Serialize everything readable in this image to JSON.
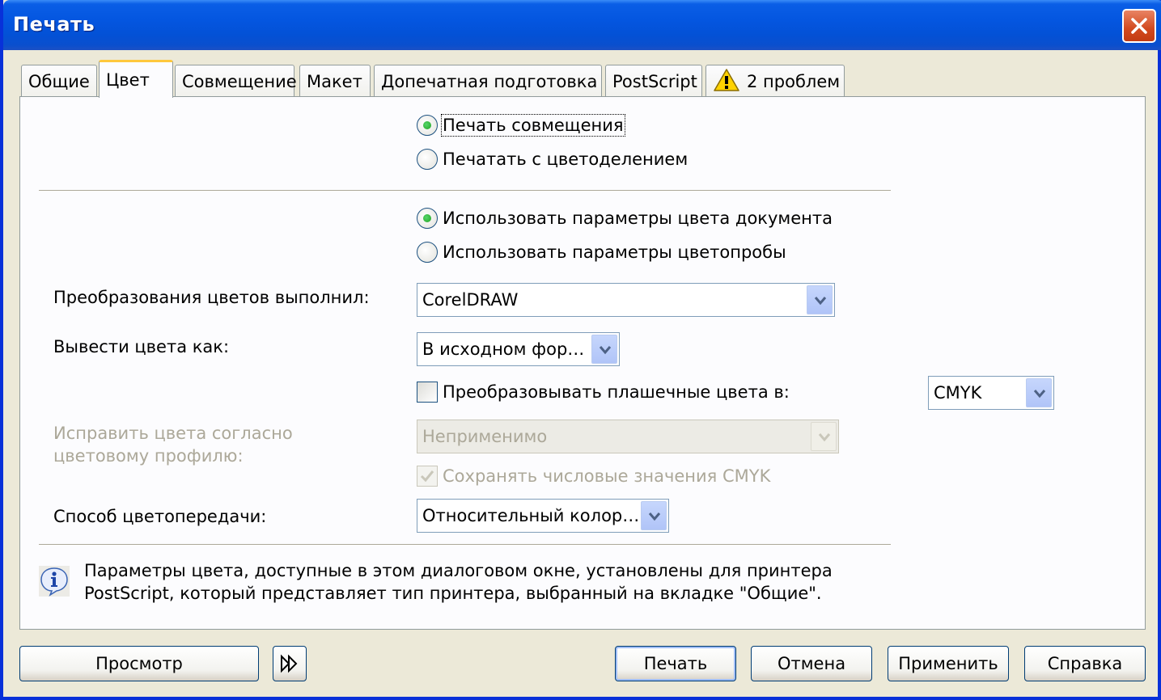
{
  "window": {
    "title": "Печать"
  },
  "tabs": [
    {
      "label": "Общие"
    },
    {
      "label": "Цвет"
    },
    {
      "label": "Совмещение"
    },
    {
      "label": "Макет"
    },
    {
      "label": "Допечатная подготовка"
    },
    {
      "label": "PostScript"
    },
    {
      "label": "2 проблем",
      "icon": "warning-icon"
    }
  ],
  "print_mode": {
    "composite": "Печать совмещения",
    "separations": "Печатать с цветоделением",
    "selected": "composite"
  },
  "color_settings": {
    "document": "Использовать параметры цвета документа",
    "proof": "Использовать параметры цветопробы",
    "selected": "document"
  },
  "conversion": {
    "label": "Преобразования цветов выполнил:",
    "value": "CorelDRAW"
  },
  "output": {
    "label": "Вывести цвета как:",
    "value": "В исходном фор…"
  },
  "spot": {
    "label": "Преобразовывать плашечные цвета в:",
    "checked": false,
    "value": "CMYK"
  },
  "profile": {
    "label_line1": "Исправить цвета согласно",
    "label_line2": "цветовому профилю:",
    "value": "Неприменимо"
  },
  "preserve_cmyk": {
    "label": "Сохранять числовые значения CMYK",
    "checked": true
  },
  "intent": {
    "label": "Способ цветопередачи:",
    "value": "Относительный колор…"
  },
  "info": {
    "line1": "Параметры цвета, доступные в этом диалоговом окне, установлены для принтера",
    "line2": "PostScript, который представляет тип принтера, выбранный на вкладке \"Общие\"."
  },
  "buttons": {
    "preview": "Просмотр",
    "print": "Печать",
    "cancel": "Отмена",
    "apply": "Применить",
    "help": "Справка"
  },
  "colors": {
    "title_bar": "#0456e0",
    "dialog_bg": "#ece9d8",
    "active_tab_accent": "#ffc83c"
  }
}
